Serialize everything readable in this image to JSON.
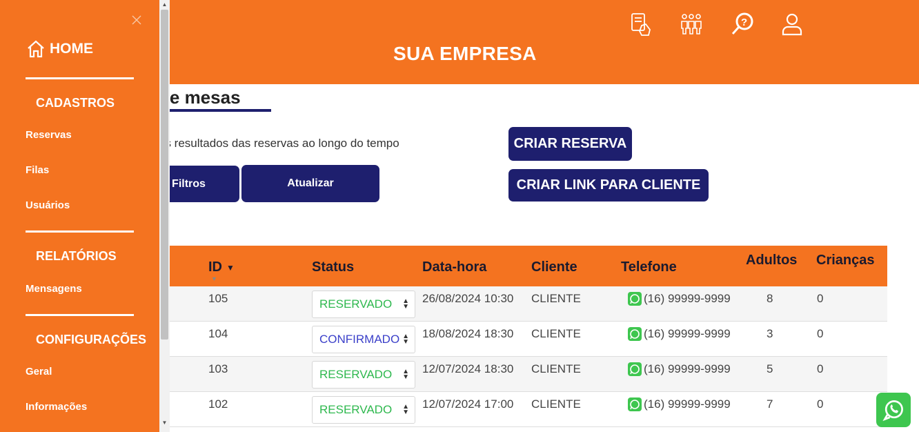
{
  "header": {
    "brand": "SUA EMPRESA",
    "icons": [
      "tablet-menu-icon",
      "people-group-icon",
      "search-help-icon",
      "user-icon"
    ]
  },
  "content": {
    "title": "de mesas",
    "subtitle": "os resultados das reservas ao longo do tempo",
    "filtros_label": "Filtros",
    "atualizar_label": "Atualizar",
    "criar_reserva_label": "CRIAR RESERVA",
    "criar_link_label": "CRIAR LINK PARA CLIENTE"
  },
  "table": {
    "columns": {
      "id": "ID",
      "status": "Status",
      "datahora": "Data-hora",
      "cliente": "Cliente",
      "telefone": "Telefone",
      "adultos": "Adultos",
      "criancas": "Crianças"
    },
    "rows": [
      {
        "id": "105",
        "status": "RESERVADO",
        "datahora": "26/08/2024 10:30",
        "cliente": "CLIENTE",
        "telefone": "(16) 99999-9999",
        "adultos": "8",
        "criancas": "0"
      },
      {
        "id": "104",
        "status": "CONFIRMADO",
        "datahora": "18/08/2024 18:30",
        "cliente": "CLIENTE",
        "telefone": "(16) 99999-9999",
        "adultos": "3",
        "criancas": "0"
      },
      {
        "id": "103",
        "status": "RESERVADO",
        "datahora": "12/07/2024 18:30",
        "cliente": "CLIENTE",
        "telefone": "(16) 99999-9999",
        "adultos": "5",
        "criancas": "0"
      },
      {
        "id": "102",
        "status": "RESERVADO",
        "datahora": "12/07/2024 17:00",
        "cliente": "CLIENTE",
        "telefone": "(16) 99999-9999",
        "adultos": "7",
        "criancas": "0"
      }
    ]
  },
  "sidebar": {
    "home": "HOME",
    "sections": {
      "cadastros": "CADASTROS",
      "relatorios": "RELATÓRIOS",
      "configuracoes": "CONFIGURAÇÕES"
    },
    "items": {
      "reservas": "Reservas",
      "filas": "Filas",
      "usuarios": "Usuários",
      "mensagens": "Mensagens",
      "geral": "Geral",
      "informacoes": "Informações"
    }
  },
  "colors": {
    "brand_orange": "#f47320",
    "navy": "#1e1f6e",
    "status_reservado": "#2eb84e",
    "status_confirmado": "#3a3fc9",
    "whatsapp_green": "#3ec64f"
  }
}
